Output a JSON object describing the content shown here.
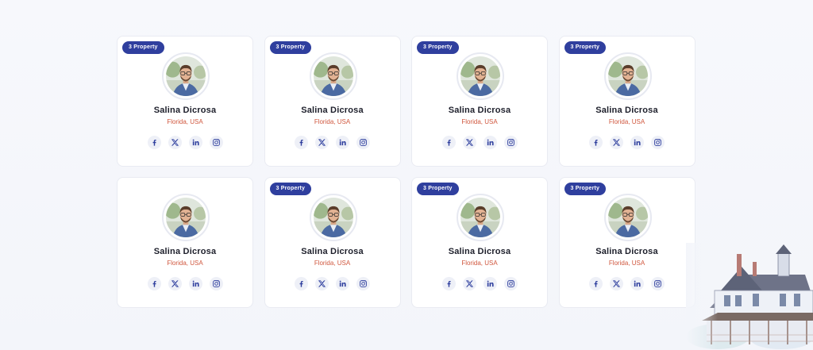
{
  "agents": [
    {
      "badge": "3 Property",
      "name": "Salina Dicrosa",
      "location": "Florida, USA"
    },
    {
      "badge": "3 Property",
      "name": "Salina Dicrosa",
      "location": "Florida, USA"
    },
    {
      "badge": "3 Property",
      "name": "Salina Dicrosa",
      "location": "Florida, USA"
    },
    {
      "badge": "3 Property",
      "name": "Salina Dicrosa",
      "location": "Florida, USA"
    },
    {
      "badge": null,
      "name": "Salina Dicrosa",
      "location": "Florida, USA"
    },
    {
      "badge": "3 Property",
      "name": "Salina Dicrosa",
      "location": "Florida, USA"
    },
    {
      "badge": "3 Property",
      "name": "Salina Dicrosa",
      "location": "Florida, USA"
    },
    {
      "badge": "3 Property",
      "name": "Salina Dicrosa",
      "location": "Florida, USA"
    }
  ],
  "social_icons": [
    "facebook-icon",
    "x-twitter-icon",
    "linkedin-icon",
    "instagram-icon"
  ],
  "colors": {
    "badge": "#2f3f9e",
    "location": "#d0573e",
    "icon": "#2f3f9e",
    "icon_bg": "#eef0f7"
  }
}
